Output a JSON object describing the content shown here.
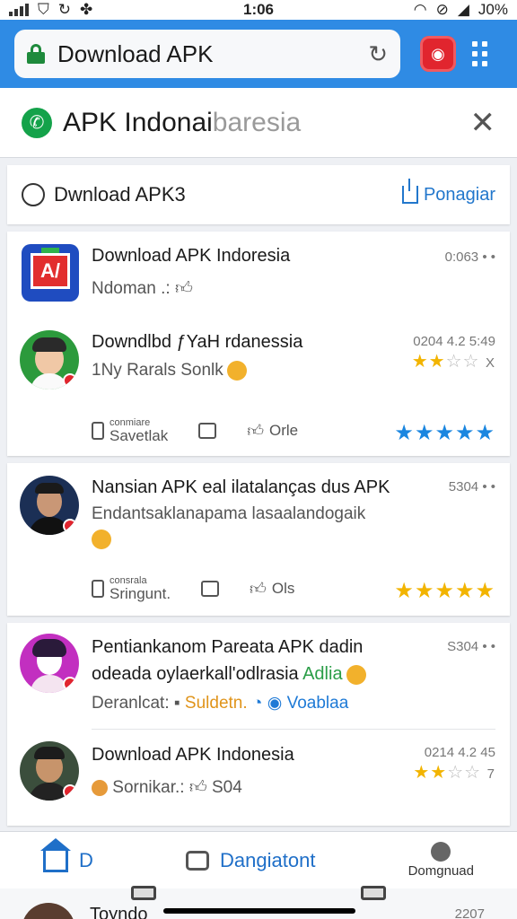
{
  "status_bar": {
    "time": "1:06",
    "battery": "J0%"
  },
  "address_bar": {
    "url": "Download APK",
    "reload_icon": "reload-icon"
  },
  "site_header": {
    "title": "APK Indonai",
    "title_ghost": "baresia"
  },
  "search_row": {
    "label": "Dwnload APK3",
    "action_label": "Ponagiar"
  },
  "cards": [
    {
      "items": [
        {
          "title": "Download APK Indoresia",
          "subtitle": "Ndoman .:",
          "meta": "0:063"
        },
        {
          "title": "Downdlbd ƒYaH rdanessia",
          "subtitle": "1Ny Rarals Sonlk",
          "meta": "0204 4.2 5:49",
          "stars_label": "X",
          "stars_filled": 2,
          "stars_total": 4,
          "star_color": "#f2b400"
        }
      ],
      "actions": {
        "a1_tiny": "conmiare",
        "a1_label": "Savetlak",
        "a3_label": "Orle"
      },
      "rating": {
        "stars_filled": 5,
        "color": "#1a86e0"
      }
    },
    {
      "items": [
        {
          "title": "Nansian APK eal ilatalanças dus APK",
          "subtitle": "Endantsaklanapama lasaalandogaik",
          "meta": "5304"
        }
      ],
      "actions": {
        "a1_tiny": "consrala",
        "a1_label": "Sringunt.",
        "a3_label": "Ols"
      },
      "rating": {
        "stars_filled": 5,
        "color": "#f2b400"
      }
    },
    {
      "items": [
        {
          "title": "Pentiankanom Pareata APK dadin",
          "title2": "odeada oylaerkall'odlrasia",
          "title2_tag": "Adlia",
          "subtitle": "Deranlcat:",
          "tag1": "Suldetn.",
          "tag2": "Voablaa",
          "meta": "S304"
        },
        {
          "title": "Download APK Indonesia",
          "subtitle": "Sornikar.:",
          "subtitle2": "S04",
          "meta": "0214 4.2 45",
          "stars_label": "7",
          "stars_filled": 2,
          "stars_total": 4,
          "star_color": "#f2b400"
        }
      ]
    }
  ],
  "bottom_nav": {
    "home_label": "D",
    "center_label": "Dangiatont",
    "right_label": "Domgnuad"
  },
  "peek": {
    "title": "Toyndo",
    "meta": "2207"
  }
}
